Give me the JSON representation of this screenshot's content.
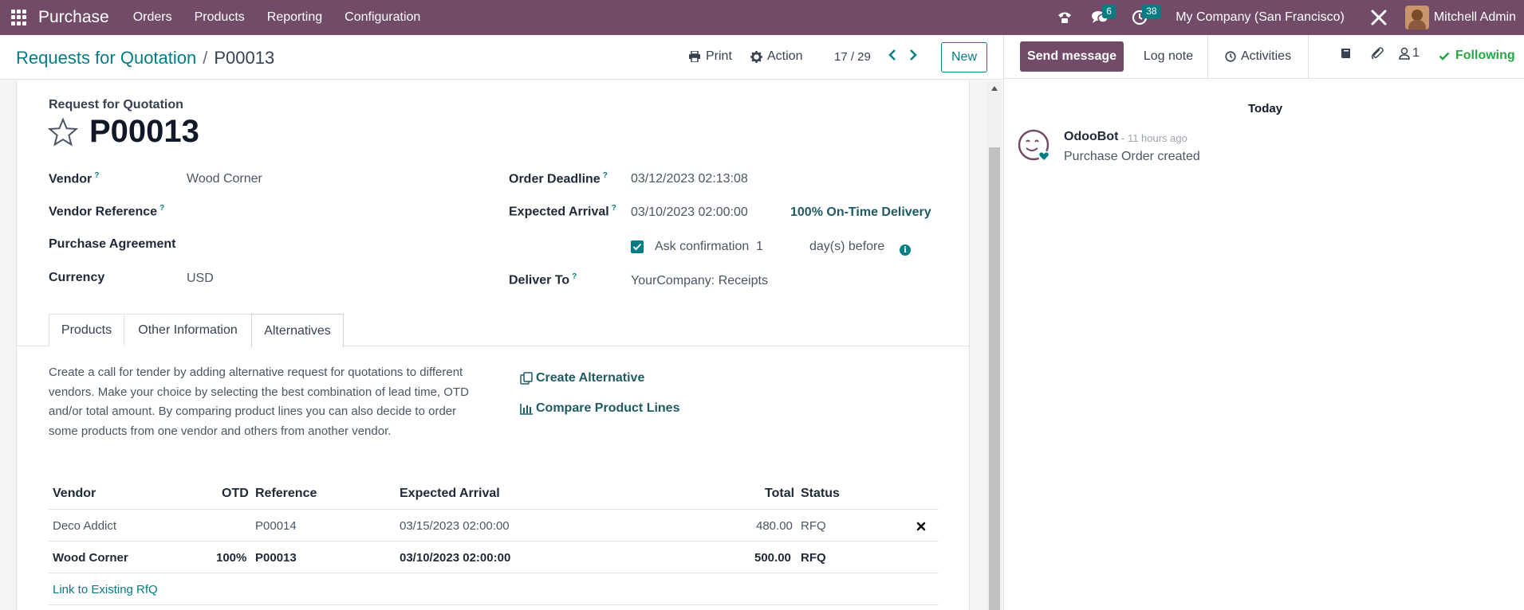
{
  "topnav": {
    "app_name": "Purchase",
    "menu": [
      "Orders",
      "Products",
      "Reporting",
      "Configuration"
    ],
    "messages_count": "6",
    "activities_count": "38",
    "company": "My Company (San Francisco)",
    "user": "Mitchell Admin",
    "accent_color": "#714b67"
  },
  "control": {
    "breadcrumb_parent": "Requests for Quotation",
    "breadcrumb_separator": "/",
    "breadcrumb_current": "P00013",
    "print_label": "Print",
    "action_label": "Action",
    "pager": "17 / 29",
    "new_label": "New"
  },
  "form": {
    "subtitle": "Request for Quotation",
    "name": "P00013",
    "fields": {
      "vendor_label": "Vendor",
      "vendor_value": "Wood Corner",
      "vendor_ref_label": "Vendor Reference",
      "agreement_label": "Purchase Agreement",
      "currency_label": "Currency",
      "currency_value": "USD",
      "deadline_label": "Order Deadline",
      "deadline_value": "03/12/2023 02:13:08",
      "arrival_label": "Expected Arrival",
      "arrival_value": "03/10/2023 02:00:00",
      "otd_label": "100% On-Time Delivery",
      "ask_confirmation_label": "Ask confirmation",
      "ask_confirmation_days": "1",
      "days_before_label": "day(s) before",
      "deliver_to_label": "Deliver To",
      "deliver_to_value": "YourCompany: Receipts",
      "help_marker": "?"
    },
    "tabs": [
      "Products",
      "Other Information",
      "Alternatives"
    ],
    "active_tab": "Alternatives"
  },
  "alternatives": {
    "description": "Create a call for tender by adding alternative request for quotations to different vendors. Make your choice by selecting the best combination of lead time, OTD and/or total amount. By comparing product lines you can also decide to order some products from one vendor and others from another vendor.",
    "create_label": "Create Alternative",
    "compare_label": "Compare Product Lines",
    "columns": [
      "Vendor",
      "OTD",
      "Reference",
      "Expected Arrival",
      "Total",
      "Status"
    ],
    "rows": [
      {
        "vendor": "Deco Addict",
        "otd": "",
        "reference": "P00014",
        "arrival": "03/15/2023 02:00:00",
        "total": "480.00",
        "status": "RFQ",
        "current": false
      },
      {
        "vendor": "Wood Corner",
        "otd": "100%",
        "reference": "P00013",
        "arrival": "03/10/2023 02:00:00",
        "total": "500.00",
        "status": "RFQ",
        "current": true
      }
    ],
    "link_existing": "Link to Existing RfQ"
  },
  "chatter": {
    "send_message": "Send message",
    "log_note": "Log note",
    "activities": "Activities",
    "followers_count": "1",
    "following": "Following",
    "date_separator": "Today",
    "messages": [
      {
        "author": "OdooBot",
        "time": "- 11 hours ago",
        "body": "Purchase Order created"
      }
    ]
  }
}
